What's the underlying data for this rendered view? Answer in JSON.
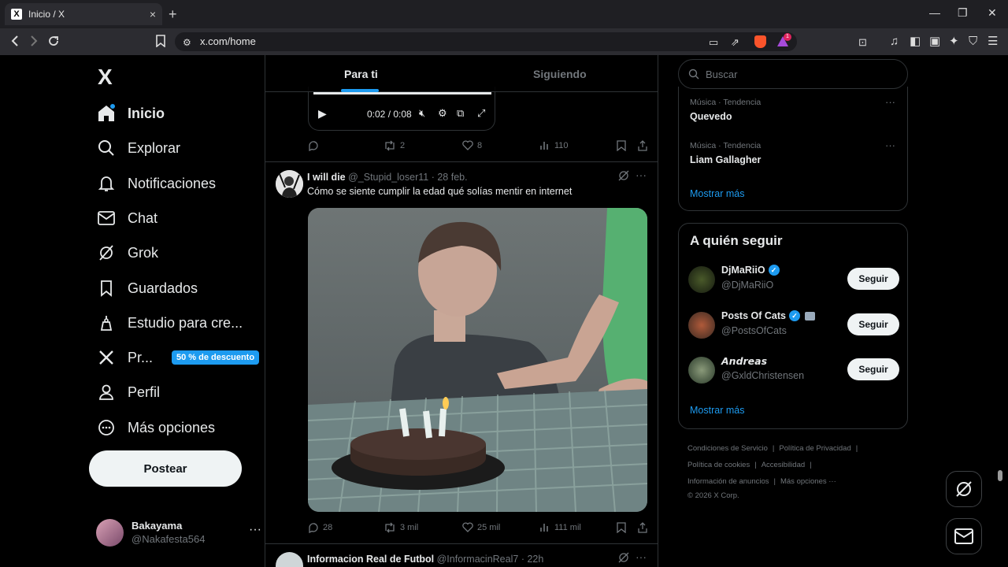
{
  "browser": {
    "tab_title": "Inicio / X",
    "tab_favicon": "x-logo",
    "tab_close": "×",
    "new_tab": "+",
    "url": "x.com/home",
    "win_minimize": "—",
    "win_maximize": "❐",
    "win_close": "✕",
    "brave_badge": "1"
  },
  "nav": {
    "logo": "X",
    "items": [
      {
        "label": "Inicio",
        "icon": "home-icon"
      },
      {
        "label": "Explorar",
        "icon": "search-icon"
      },
      {
        "label": "Notificaciones",
        "icon": "bell-icon"
      },
      {
        "label": "Chat",
        "icon": "mail-icon"
      },
      {
        "label": "Grok",
        "icon": "grok-icon"
      },
      {
        "label": "Guardados",
        "icon": "bookmark-icon"
      },
      {
        "label": "Estudio para cre...",
        "icon": "studio-icon"
      },
      {
        "label": "Pr...",
        "icon": "x-premium-icon",
        "badge": "50 % de descuento"
      },
      {
        "label": "Perfil",
        "icon": "person-icon"
      },
      {
        "label": "Más opciones",
        "icon": "more-circle-icon"
      }
    ],
    "post_button": "Postear",
    "account": {
      "name": "Bakayama",
      "handle": "@Nakafesta564",
      "more": "···"
    }
  },
  "timeline": {
    "tabs": {
      "for_you": "Para ti",
      "following": "Siguiendo"
    },
    "video": {
      "time": "0:02 / 0:08",
      "progress": 1.0
    },
    "prev_actions": {
      "replies": "",
      "reposts": "2",
      "likes": "8",
      "views": "110"
    },
    "tweet": {
      "name": "I will die",
      "handle": "@_Stupid_loser11",
      "date": "· 28 feb.",
      "text": "Cómo se siente cumplir la edad qué solías mentir en internet",
      "replies": "28",
      "reposts": "3 mil",
      "likes": "25 mil",
      "views": "111 mil",
      "more": "···"
    },
    "next_tweet": {
      "name": "Informacion Real de Futbol",
      "handle": "@InformacinReal7",
      "date": "· 22h",
      "more": "···"
    }
  },
  "right": {
    "search_placeholder": "Buscar",
    "trends": [
      {
        "category": "Música · Tendencia",
        "name": "Quevedo"
      },
      {
        "category": "Música · Tendencia",
        "name": "Liam Gallagher"
      }
    ],
    "trend_more": "···",
    "trends_show_more": "Mostrar más",
    "who_to_follow": {
      "title": "A quién seguir",
      "accounts": [
        {
          "name": "DjMaRiiO",
          "handle": "@DjMaRiiO",
          "verified": true
        },
        {
          "name": "Posts Of Cats",
          "handle": "@PostsOfCats",
          "verified": true
        },
        {
          "name": "𝘼𝙣𝙙𝙧𝙚𝙖𝙨",
          "handle": "@GxldChristensen",
          "verified": false
        }
      ],
      "follow_label": "Seguir",
      "show_more": "Mostrar más"
    },
    "footer": {
      "row1": [
        "Condiciones de Servicio",
        "|",
        "Política de Privacidad",
        "|"
      ],
      "row2": [
        "Política de cookies",
        "|",
        "Accesibilidad",
        "|"
      ],
      "row3": [
        "Información de anuncios",
        "|",
        "Más opciones ···"
      ],
      "copyright": "© 2026 X Corp."
    }
  },
  "colors": {
    "accent": "#1d9bf0",
    "bg": "#000000",
    "border": "#2f3336",
    "muted": "#71767b"
  }
}
